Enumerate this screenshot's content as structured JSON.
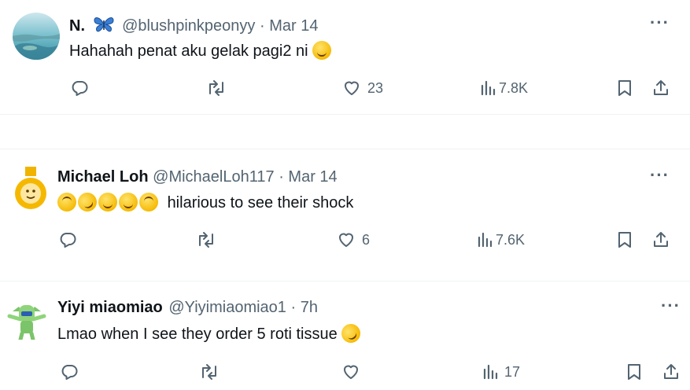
{
  "tweets": [
    {
      "name": "N.",
      "handle": "@blushpinkpeonyy",
      "dot": "·",
      "time": "Mar 14",
      "text": "Hahahah penat aku gelak pagi2 ni",
      "likes": "23",
      "views": "7.8K",
      "more": "···"
    },
    {
      "name": "Michael Loh",
      "handle": "@MichaelLoh117",
      "dot": "·",
      "time": "Mar 14",
      "text": "hilarious to see their shock",
      "likes": "6",
      "views": "7.6K",
      "more": "···"
    },
    {
      "name": "Yiyi miaomiao",
      "handle": "@Yiyimiaomiao1",
      "dot": "·",
      "time": "7h",
      "text": "Lmao when I see they order 5 roti tissue",
      "likes": "",
      "views": "17",
      "more": "···"
    }
  ],
  "icons": {
    "reply": "reply-icon",
    "repost": "repost-icon",
    "like": "heart-icon",
    "views": "views-icon",
    "bookmark": "bookmark-icon",
    "share": "share-icon"
  },
  "colors": {
    "text": "#0f1419",
    "secondary": "#536471",
    "divider": "#eff3f4"
  }
}
